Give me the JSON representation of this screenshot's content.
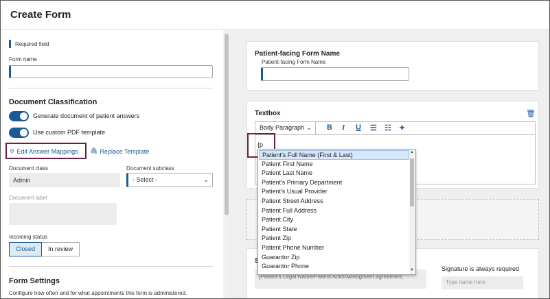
{
  "header": {
    "title": "Create Form"
  },
  "left": {
    "required_note": "Required field",
    "form_name_label": "Form name",
    "form_name_value": "",
    "doc_class_heading": "Document Classification",
    "toggle1_label": "Generate document of patient answers",
    "toggle2_label": "Use custom PDF template",
    "edit_mappings": "Edit Answer Mappings",
    "replace_template": "Replace Template",
    "doc_class_label": "Document class",
    "doc_class_value": "Admin",
    "doc_subclass_label": "Document subclass",
    "doc_subclass_value": "- Select -",
    "doc_label_label": "Document label",
    "incoming_status_label": "Incoming status",
    "status_options": [
      "Closed",
      "In review"
    ],
    "form_settings_heading": "Form Settings",
    "form_settings_desc": "Configure how often and for what appointments this form is administered."
  },
  "right": {
    "patient_form_name_title": "Patient-facing Form Name",
    "patient_form_name_label": "Patient-facing Form Name",
    "textbox_title": "Textbox",
    "paragraph_style": "Body Paragraph",
    "editor_text": "{p",
    "sig_title_partial": "S",
    "sig_required": "Signature is always required",
    "sig_placeholder": "Type name here",
    "sig_agreement": "[Patient's Legal Name/Patient Acknowledgment agreement."
  },
  "dropdown": {
    "items": [
      "Patient's Full Name (First & Last)",
      "Patient First Name",
      "Patient Last Name",
      "Patient's Primary Department",
      "Patient's Usual Provider",
      "Patient Street Address",
      "Patient Full Address",
      "Patient City",
      "Patient State",
      "Patient Zip",
      "Patient Phone Number",
      "Guarantor Zip",
      "Guarantor Phone"
    ]
  },
  "colors": {
    "accent": "#1a5a96",
    "highlight": "#6a1f4b"
  }
}
